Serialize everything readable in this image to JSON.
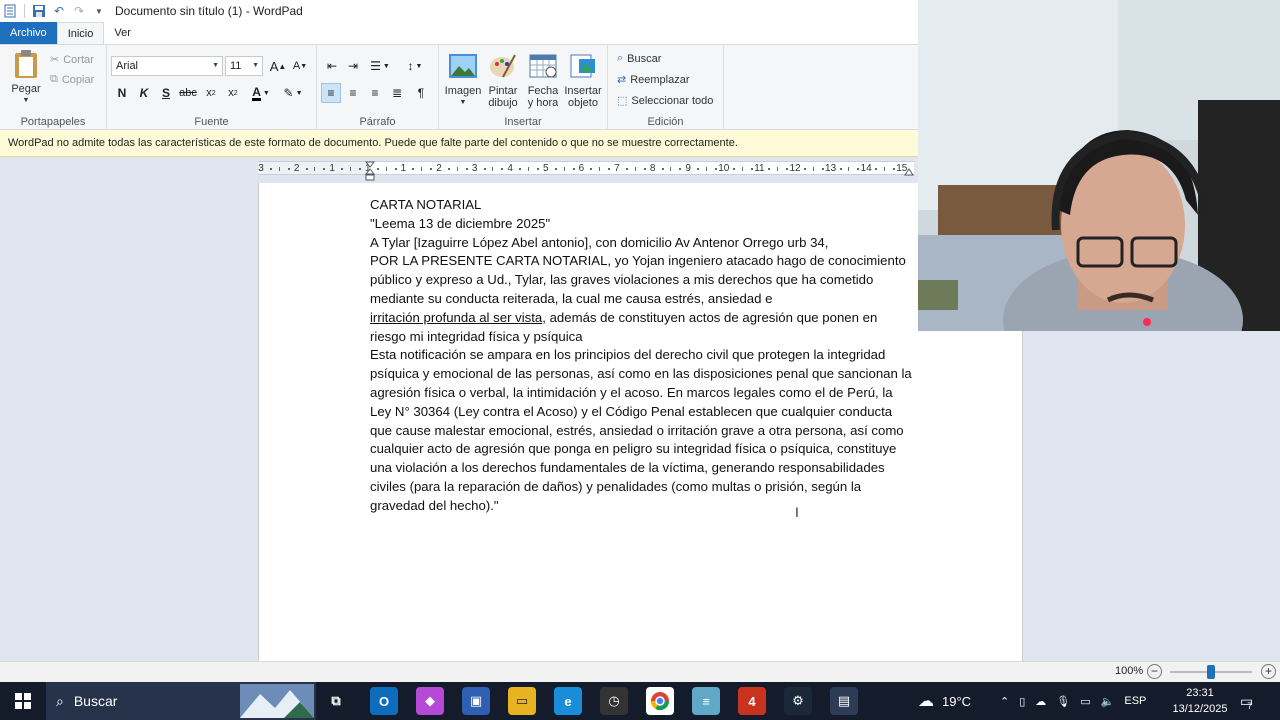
{
  "window": {
    "title": "Documento sin título (1) - WordPad"
  },
  "tabs": [
    {
      "label": "Archivo"
    },
    {
      "label": "Inicio"
    },
    {
      "label": "Ver"
    }
  ],
  "ribbon": {
    "clipboard": {
      "group": "Portapapeles",
      "paste": "Pegar",
      "cut": "Cortar",
      "copy": "Copiar"
    },
    "font": {
      "group": "Fuente",
      "family": "Arial",
      "size": "11",
      "bold": "N",
      "italic": "K",
      "underline": "S",
      "strike": "abc"
    },
    "paragraph": {
      "group": "Párrafo"
    },
    "insert": {
      "group": "Insertar",
      "image": "Imagen",
      "paint1": "Pintar",
      "paint2": "dibujo",
      "datetime1": "Fecha",
      "datetime2": "y hora",
      "object1": "Insertar",
      "object2": "objeto"
    },
    "edit": {
      "group": "Edición",
      "find": "Buscar",
      "replace": "Reemplazar",
      "select_all": "Seleccionar todo"
    }
  },
  "infobar": {
    "message": "WordPad no admite todas las características de este formato de documento. Puede que falte parte del contenido o que no se muestre correctamente."
  },
  "ruler": {
    "labels": [
      "3",
      "2",
      "1",
      "1",
      "1",
      "2",
      "3",
      "4",
      "5",
      "6",
      "7",
      "8",
      "9",
      "10",
      "11",
      "12",
      "13",
      "14",
      "15"
    ]
  },
  "document": {
    "lines": [
      "CARTA NOTARIAL",
      "\"Leema 13 de diciembre 2025\"",
      "A Tylar [Izaguirre López Abel antonio], con domicilio Av Antenor Orrego urb 34,",
      "POR LA PRESENTE CARTA NOTARIAL, yo Yojan ingeniero atacado hago de conocimiento público y expreso a Ud., Tylar, las graves violaciones a mis derechos que ha cometido mediante su conducta reiterada, la cual me causa estrés, ansiedad e"
    ],
    "underlined": "irritación profunda al ser vista",
    "after_underline": ", además de constituyen actos de agresión que ponen en riesgo mi integridad física y psíquica",
    "paragraph2": "Esta notificación se ampara en los principios del derecho civil que protegen la integridad psíquica y emocional de las personas, así como en las disposiciones penal que sancionan la agresión física o verbal, la intimidación y el acoso. En marcos legales como el de Perú, la Ley N° 30364 (Ley contra el Acoso) y el Código Penal establecen que cualquier conducta que cause malestar emocional, estrés, ansiedad o irritación grave a otra persona, así como cualquier acto de agresión que ponga en peligro su integridad física o psíquica, constituye una violación a los derechos fundamentales de la víctima, generando responsabilidades civiles (para la reparación de daños) y penalidades (como multas o prisión, según la gravedad del hecho).\""
  },
  "status": {
    "zoom": "100%",
    "zoom_level_percent": 100
  },
  "taskbar": {
    "search_label": "Buscar",
    "weather": "19°C",
    "lang": "ESP",
    "time": "23:31",
    "date": "13/12/2025",
    "notifications": "7"
  },
  "colors": {
    "accent": "#1f6fbf",
    "taskbar": "#141c2b",
    "infobar": "#fffbd8"
  }
}
